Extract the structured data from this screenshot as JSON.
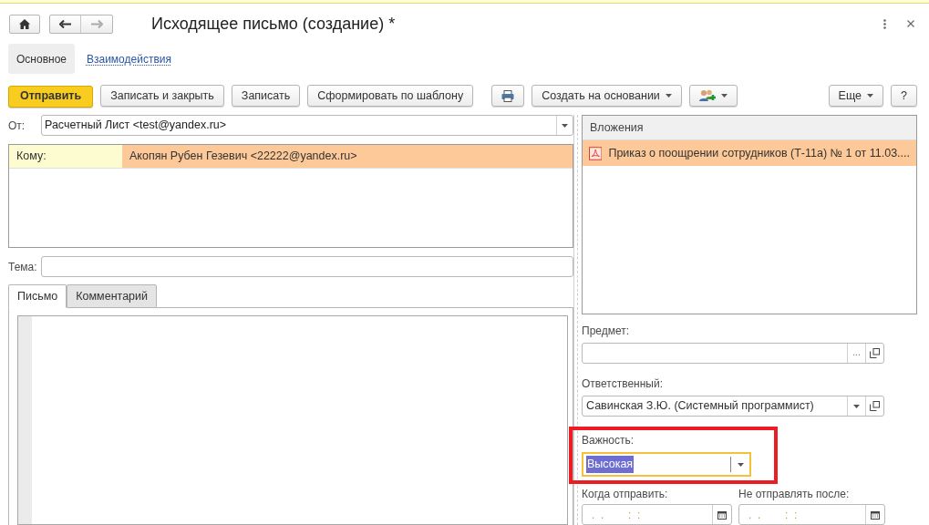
{
  "window": {
    "title": "Исходящее письмо (создание) *"
  },
  "nav_tabs": [
    {
      "label": "Основное",
      "selected": true
    },
    {
      "label": "Взаимодействия",
      "selected": false
    }
  ],
  "toolbar": {
    "left": [
      {
        "kind": "primary",
        "label": "Отправить"
      },
      {
        "kind": "text",
        "label": "Записать и закрыть"
      },
      {
        "kind": "text",
        "label": "Записать"
      },
      {
        "kind": "text",
        "label": "Сформировать по шаблону"
      },
      {
        "kind": "print"
      },
      {
        "kind": "menu",
        "label": "Создать на основании"
      },
      {
        "kind": "people"
      }
    ],
    "right": [
      {
        "kind": "menu",
        "label": "Еще"
      },
      {
        "kind": "text",
        "label": "?"
      }
    ]
  },
  "from": {
    "label": "От:",
    "value": "Расчетный Лист <test@yandex.ru>"
  },
  "recipients": [
    {
      "label": "Кому:",
      "value": "Акопян Рубен Гезевич <22222@yandex.ru>",
      "selected": true
    }
  ],
  "subject": {
    "label": "Тема:"
  },
  "body_tabs": [
    {
      "label": "Письмо",
      "selected": true
    },
    {
      "label": "Комментарий",
      "selected": false
    }
  ],
  "attachments": {
    "title": "Вложения",
    "items": [
      {
        "name": "Приказ о поощрении сотрудников (Т-11а) № 1 от 11.03....",
        "selected": true
      }
    ]
  },
  "fields": [
    {
      "kind": "ref",
      "label": "Предмет:",
      "choose": "...",
      "highlighted": false,
      "focused": false
    },
    {
      "kind": "dropdown_ref",
      "label": "Ответственный:",
      "value": "Савинская З.Ю. (Системный программист)",
      "highlighted": false,
      "focused": false
    },
    {
      "kind": "dropdown",
      "label": "Важность:",
      "value": "Высокая",
      "highlighted": true,
      "focused": true
    }
  ],
  "dates": [
    {
      "label": "Когда отправить:",
      "value": ".  .        :  :"
    },
    {
      "label": "Не отправлять после:",
      "value": ".  .        :  :"
    }
  ]
}
